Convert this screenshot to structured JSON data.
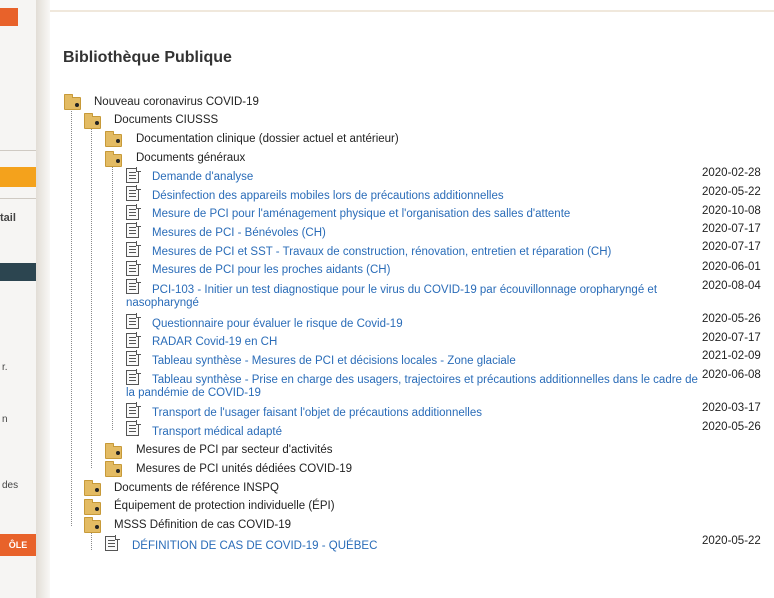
{
  "sidebar": {
    "label_detail": "tail",
    "label_r": "r.",
    "label_n": "n",
    "label_des": "des",
    "button_label": "ÔLE"
  },
  "page": {
    "title": "Bibliothèque Publique"
  },
  "tree": {
    "root": "Nouveau coronavirus COVID-19",
    "documents_ciusss": "Documents CIUSSS",
    "doc_clinique": "Documentation clinique (dossier actuel et antérieur)",
    "docs_generaux": "Documents généraux",
    "documents": [
      {
        "title": "Demande d'analyse",
        "date": "2020-02-28"
      },
      {
        "title": "Désinfection des appareils mobiles lors de précautions additionnelles",
        "date": "2020-05-22"
      },
      {
        "title": "Mesure de PCI pour l'aménagement physique et l'organisation des salles d'attente",
        "date": "2020-10-08"
      },
      {
        "title": "Mesures de PCI - Bénévoles (CH)",
        "date": "2020-07-17"
      },
      {
        "title": "Mesures de PCI et SST - Travaux de construction, rénovation, entretien et réparation (CH)",
        "date": "2020-07-17"
      },
      {
        "title": "Mesures de PCI pour les proches aidants (CH)",
        "date": "2020-06-01"
      },
      {
        "title": "PCI-103 - Initier un test diagnostique pour le virus du COVID-19 par écouvillonnage oropharyngé et nasopharyngé",
        "date": "2020-08-04"
      },
      {
        "title": "Questionnaire pour évaluer le risque de Covid-19",
        "date": "2020-05-26"
      },
      {
        "title": "RADAR Covid-19 en CH",
        "date": "2020-07-17"
      },
      {
        "title": "Tableau synthèse - Mesures de PCI et décisions locales - Zone glaciale",
        "date": "2021-02-09"
      },
      {
        "title": "Tableau synthèse - Prise en charge des usagers, trajectoires et précautions additionnelles dans le cadre de la pandémie de COVID-19",
        "date": "2020-06-08"
      },
      {
        "title": "Transport de l'usager faisant l'objet de précautions additionnelles",
        "date": "2020-03-17"
      },
      {
        "title": "Transport médical adapté",
        "date": "2020-05-26"
      }
    ],
    "pci_secteur": "Mesures de PCI par secteur d'activités",
    "pci_unites": "Mesures de PCI unités dédiées COVID-19",
    "ref_inspq": "Documents de référence INSPQ",
    "epi": "Équipement de protection individuelle (ÉPI)",
    "msss": "MSSS Définition de cas COVID-19",
    "msss_doc": {
      "title": "DÉFINITION DE CAS DE COVID-19 - QUÉBEC",
      "date": "2020-05-22"
    }
  },
  "colors": {
    "link": "#2a6cb8",
    "folder": "#e3bb63",
    "accent_orange": "#e8622a",
    "accent_yellow": "#f4a21c",
    "dark": "#2c4550"
  }
}
